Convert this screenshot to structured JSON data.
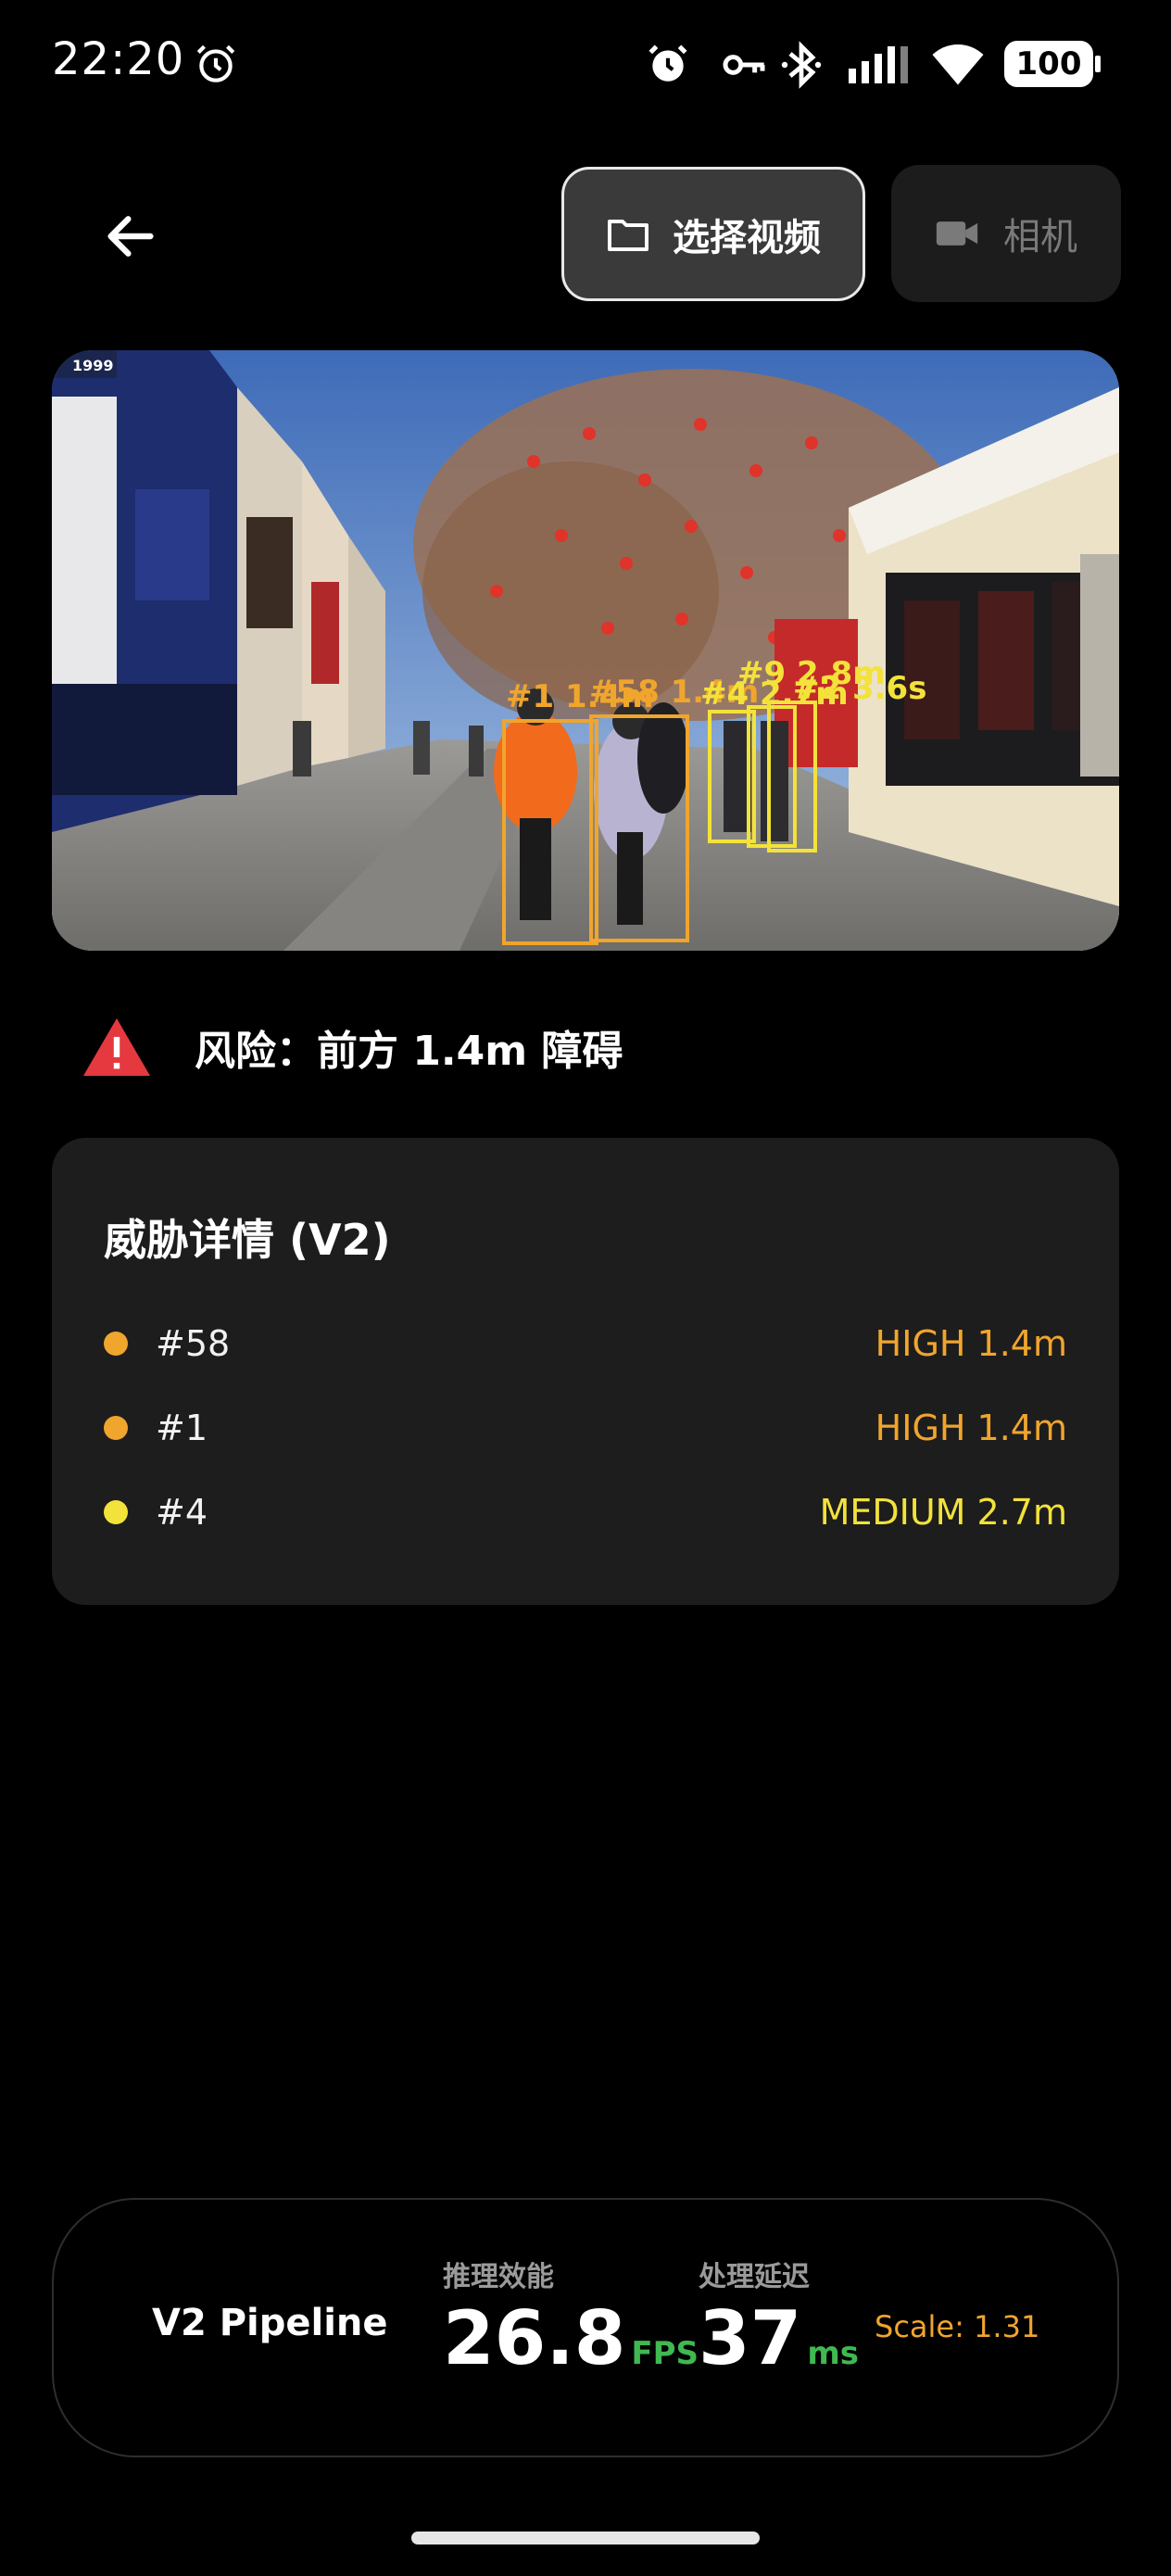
{
  "status_bar": {
    "time": "22:20",
    "battery": "100",
    "icons": [
      "alarm-icon",
      "vpn-key-icon",
      "bluetooth-icon",
      "signal-icon",
      "wifi-icon",
      "battery-icon"
    ]
  },
  "toolbar": {
    "back_icon": "arrow-left-icon",
    "select_video_label": "选择视频",
    "select_video_icon": "folder-icon",
    "camera_label": "相机",
    "camera_icon": "video-camera-icon"
  },
  "video": {
    "overlay_text_1": "#1 1.4m",
    "overlay_text_2": "#58 1.4m",
    "overlay_text_3": "#4 2.7m",
    "overlay_text_4": "#9 2.8m",
    "overlay_text_5": "#2 3.6s",
    "box_color_high": "#f0a52d",
    "box_color_medium": "#f3e23a",
    "storefront_badge": "1999"
  },
  "risk": {
    "icon": "warning-triangle-icon",
    "icon_color": "#e5393f",
    "text": "风险：前方 1.4m 障碍"
  },
  "threats": {
    "title": "威胁详情 (V2)",
    "items": [
      {
        "id": "#58",
        "value": "HIGH 1.4m",
        "color": "#f0a52d"
      },
      {
        "id": "#1",
        "value": "HIGH 1.4m",
        "color": "#f0a52d"
      },
      {
        "id": "#4",
        "value": "MEDIUM 2.7m",
        "color": "#f3e23a"
      }
    ]
  },
  "metrics": {
    "pipeline": "V2 Pipeline",
    "inference_label": "推理效能",
    "inference_value": "26.8",
    "inference_unit": "FPS",
    "latency_label": "处理延迟",
    "latency_value": "37",
    "latency_unit": "ms",
    "scale": "Scale: 1.31",
    "accent_green": "#3fb950"
  }
}
